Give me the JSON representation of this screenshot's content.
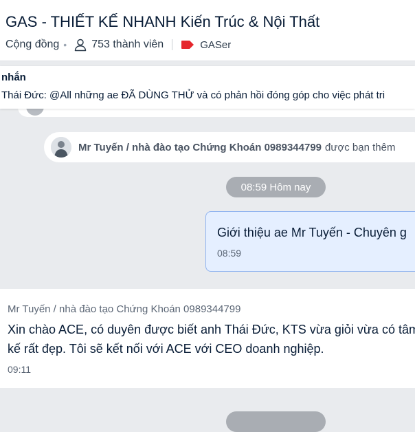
{
  "header": {
    "title": "GAS - THIẾT KẾ NHANH Kiến Trúc & Nội Thất",
    "community": "Cộng đồng",
    "members": "753 thành viên",
    "tag": "GASer",
    "tag_color": "#e5262c"
  },
  "pinned": {
    "title": "nhắn",
    "text": "Thái Đức: @All những ae ĐÃ DÙNG THỬ và có phản hồi đóng góp cho việc phát tri"
  },
  "notice": {
    "name": "Mr Tuyến / nhà đào tạo Chứng Khoán 0989344799",
    "action": "được bạn thêm"
  },
  "time_separator": "08:59 Hôm nay",
  "own_message": {
    "text": "Giới thiệu ae Mr Tuyến - Chuyên g",
    "time": "08:59"
  },
  "incoming_message": {
    "sender": "Mr Tuyến / nhà đào tạo Chứng Khoán 0989344799",
    "line1": "Xin chào ACE, có duyên được biết anh Thái Đức, KTS vừa giỏi vừa có tâm",
    "line2": "kế rất đẹp. Tôi sẽ kết nối với ACE với CEO doanh nghiệp.",
    "time": "09:11"
  },
  "colors": {
    "accent_bubble": "#e5efff",
    "bubble_border": "#8fb3ef",
    "background": "#e9ebee"
  }
}
